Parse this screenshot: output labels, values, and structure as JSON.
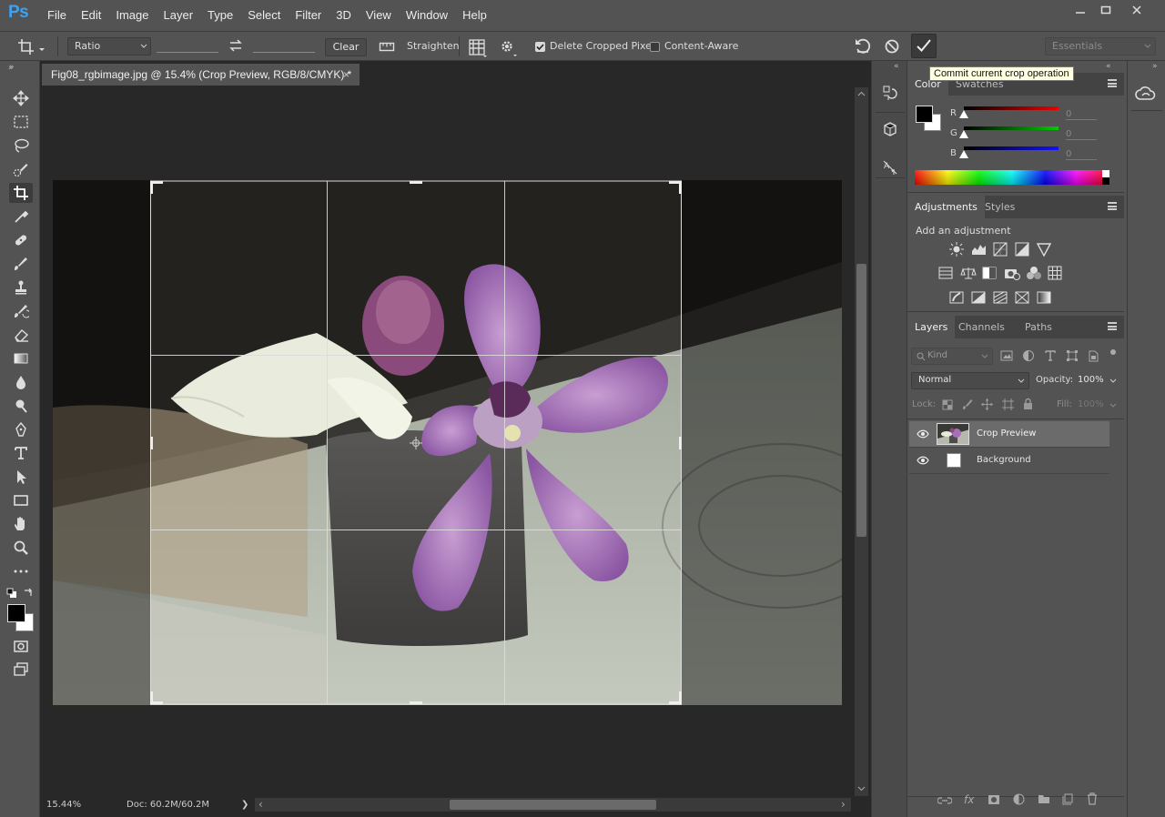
{
  "app": {
    "logo": "Ps"
  },
  "menu": [
    "File",
    "Edit",
    "Image",
    "Layer",
    "Type",
    "Select",
    "Filter",
    "3D",
    "View",
    "Window",
    "Help"
  ],
  "options": {
    "ratio": "Ratio",
    "clear": "Clear",
    "straighten": "Straighten",
    "delete_cropped": "Delete Cropped Pixels",
    "delete_cropped_checked": true,
    "content_aware": "Content-Aware",
    "content_aware_checked": false,
    "workspace": "Essentials"
  },
  "tooltip": "Commit current crop operation",
  "document": {
    "tab_title": "Fig08_rgbimage.jpg @ 15.4% (Crop Preview, RGB/8/CMYK) *",
    "close": "×",
    "zoom": "15.44%",
    "doc_info": "Doc: 60.2M/60.2M",
    "arrow_more": "❯",
    "scroll_left": "‹",
    "scroll_right": "›",
    "vertical_scroll_position": 0.4
  },
  "color_panel": {
    "tabs": [
      "Color",
      "Swatches"
    ],
    "channels": [
      {
        "label": "R",
        "value": "0",
        "color": "#d01818"
      },
      {
        "label": "G",
        "value": "0",
        "color": "#18c018"
      },
      {
        "label": "B",
        "value": "0",
        "color": "#1818d8"
      }
    ]
  },
  "adjustments_panel": {
    "tabs": [
      "Adjustments",
      "Styles"
    ],
    "title": "Add an adjustment"
  },
  "layers_panel": {
    "tabs": [
      "Layers",
      "Channels",
      "Paths"
    ],
    "filter": "Kind",
    "blend_mode": "Normal",
    "opacity_label": "Opacity:",
    "opacity": "100%",
    "lock_label": "Lock:",
    "fill_label": "Fill:",
    "fill": "100%",
    "layers": [
      {
        "name": "Crop Preview",
        "selected": true
      },
      {
        "name": "Background",
        "selected": false
      }
    ]
  },
  "colors": {
    "accent": "#3fa1f0",
    "foreground": "#000000",
    "background": "#ffffff"
  }
}
